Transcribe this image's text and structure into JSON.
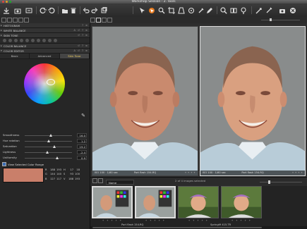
{
  "window": {
    "title": "Workshop Session - 2. Tools"
  },
  "toolbar": {
    "icons": [
      "import-icon",
      "capture-icon",
      "tethered-icon",
      "rotate-left-icon",
      "rotate-right-icon",
      "trash-icon",
      "undo-icon",
      "redo-icon",
      "pan-tool-icon",
      "cursor-tool-icon",
      "zoom-tool-icon",
      "crop-tool-icon",
      "keystone-tool-icon",
      "spot-tool-icon",
      "picker-tool-icon",
      "search-icon",
      "compare-icon",
      "loupe-icon",
      "exposure-warning-icon",
      "process-icon",
      "stop-icon"
    ]
  },
  "panel": {
    "sections": [
      {
        "label": "HISTOGRAM"
      },
      {
        "label": "WHITE BALANCE"
      },
      {
        "label": "SKIN TONE"
      },
      {
        "label": "COLOR BALANCE"
      },
      {
        "label": "COLOR EDITOR"
      }
    ],
    "tabs": [
      {
        "label": "Basic"
      },
      {
        "label": "Advanced"
      },
      {
        "label": "Skin Tone"
      }
    ],
    "sliders": [
      {
        "label": "Smoothness",
        "value": "16.0",
        "pos": 0.55
      },
      {
        "label": "Hue rotation",
        "value": "1.2",
        "pos": 0.5
      },
      {
        "label": "Saturation",
        "value": "19.2",
        "pos": 0.62
      },
      {
        "label": "Lightness",
        "value": "-2.4",
        "pos": 0.48
      },
      {
        "label": "Uniformity",
        "value": "0.9",
        "pos": 0.68
      }
    ],
    "view_range_label": "View Selected Color Range",
    "readouts": [
      [
        "R",
        "188",
        "193",
        "H",
        "17",
        "18"
      ],
      [
        "G",
        "144",
        "140",
        "S",
        "93",
        "100"
      ],
      [
        "B",
        "127",
        "117",
        "V",
        "188",
        "193"
      ]
    ],
    "swatch_color": "#c97f6a",
    "accent_color": "#f0d060"
  },
  "viewer": {
    "left": {
      "iso": "ISO 100",
      "shutter": "1/60 sec",
      "file": "Port flash 154.RQ"
    },
    "right": {
      "iso": "ISO 100",
      "shutter": "1/60 sec",
      "file": "Port flash 154.RQ"
    }
  },
  "browser": {
    "sort_label": "Name",
    "count_text": "2 of 4 images selected",
    "thumbnails": [
      {
        "caption": "Port flash 154.RQ",
        "selected": true
      },
      {
        "caption": "",
        "selected": true
      },
      {
        "caption": "Springt9 415.TR",
        "selected": false
      },
      {
        "caption": "",
        "selected": false
      }
    ]
  }
}
